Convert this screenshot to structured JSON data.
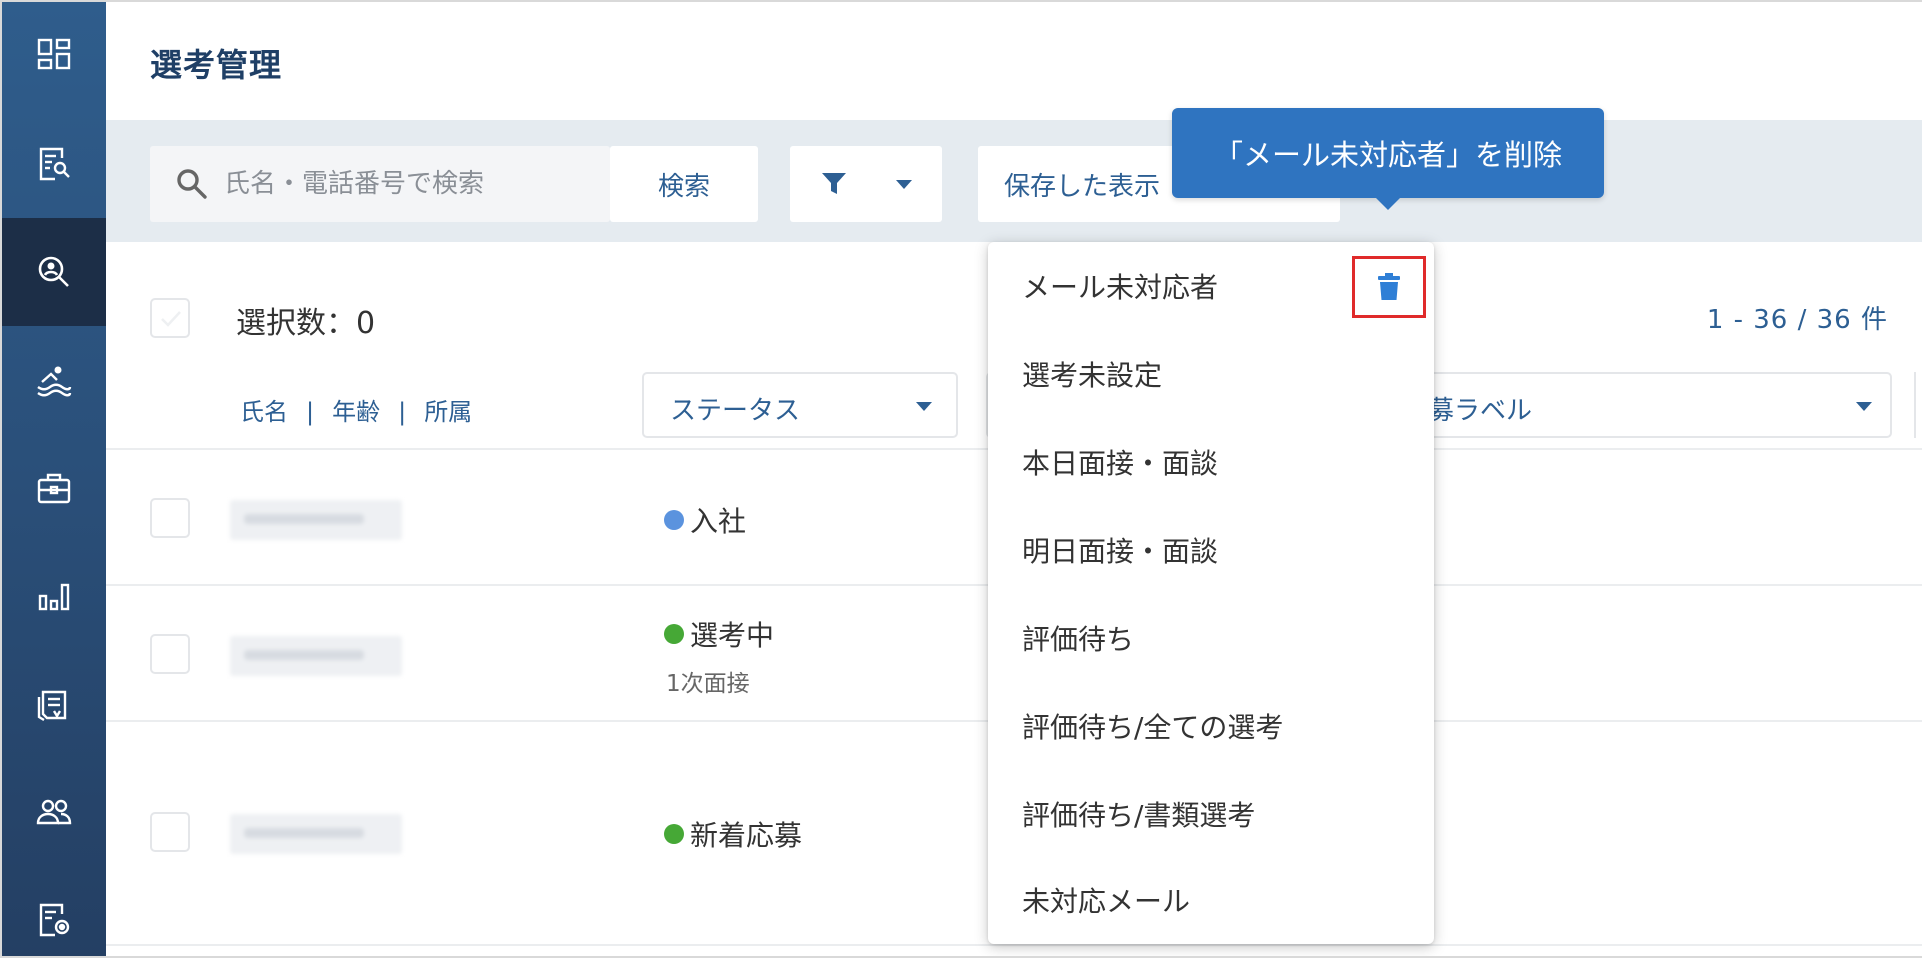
{
  "page": {
    "title": "選考管理"
  },
  "sidebar": {
    "items": [
      {
        "name": "dashboard-icon",
        "active": false
      },
      {
        "name": "document-search-icon",
        "active": false
      },
      {
        "name": "person-search-icon",
        "active": true
      },
      {
        "name": "swimmer-icon",
        "active": false
      },
      {
        "name": "briefcase-icon",
        "active": false
      },
      {
        "name": "bar-chart-icon",
        "active": false
      },
      {
        "name": "documents-icon",
        "active": false
      },
      {
        "name": "users-icon",
        "active": false
      },
      {
        "name": "document-settings-icon",
        "active": false
      }
    ]
  },
  "toolbar": {
    "search_placeholder": "氏名・電話番号で検索",
    "search_button": "検索",
    "saved_view_label": "保存した表示"
  },
  "selection": {
    "count_label": "選択数：0"
  },
  "pagination": {
    "label": "1 - 36 / 36 件"
  },
  "columns": {
    "links": [
      "氏名",
      "年齢",
      "所属"
    ],
    "status_filter": "ステータス",
    "label_filter": "募ラベル"
  },
  "rows": [
    {
      "status": "入社",
      "status_color": "#5b93de",
      "substatus": ""
    },
    {
      "status": "選考中",
      "status_color": "#46a836",
      "substatus": "1次面接"
    },
    {
      "status": "新着応募",
      "status_color": "#46a836",
      "substatus": ""
    }
  ],
  "menu": {
    "items": [
      "メール未対応者",
      "選考未設定",
      "本日面接・面談",
      "明日面接・面談",
      "評価待ち",
      "評価待ち/全ての選考",
      "評価待ち/書類選考",
      "未対応メール"
    ]
  },
  "tooltip": {
    "text": "「メール未対応者」を削除"
  },
  "colors": {
    "accent": "#2d5f93",
    "tooltip": "#2f74c0",
    "highlight": "#e02a2a",
    "trash": "#2f7fd6"
  }
}
